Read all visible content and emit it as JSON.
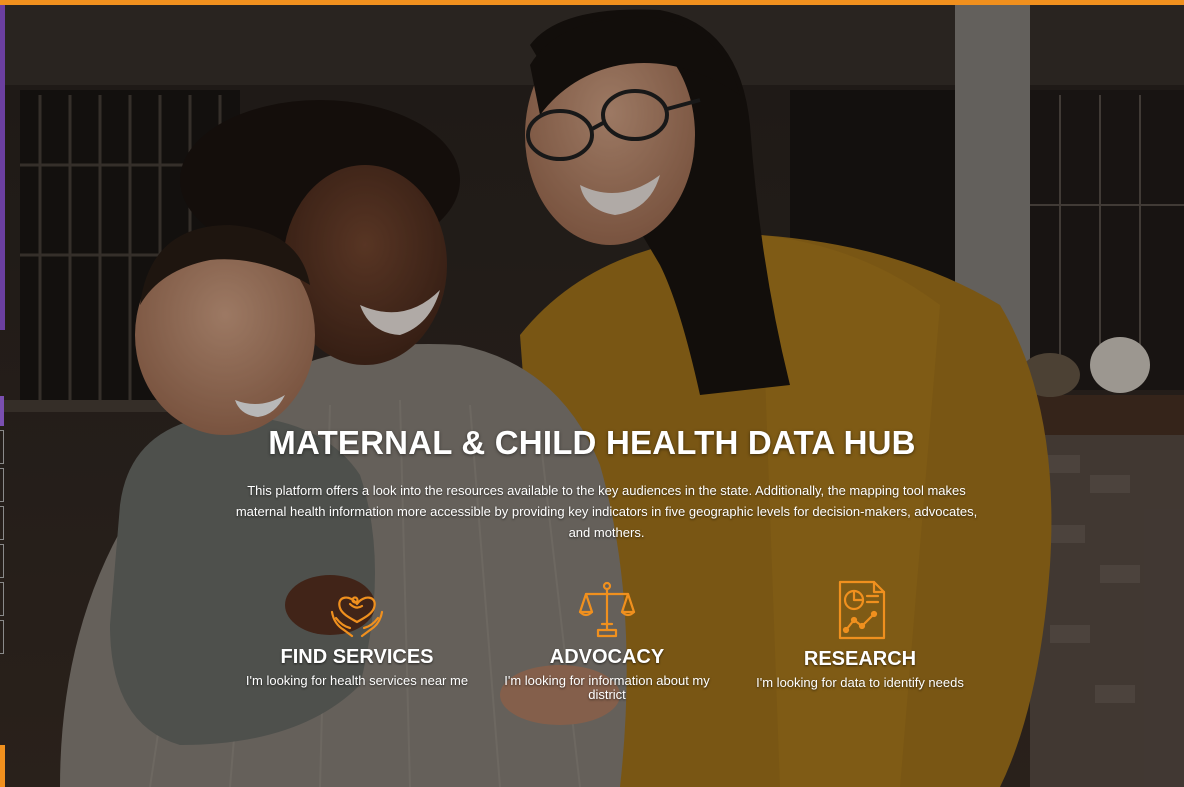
{
  "hero": {
    "title": "MATERNAL & CHILD HEALTH DATA HUB",
    "description": "This platform offers a look into the resources available to the key audiences in the state. Additionally, the mapping tool makes maternal health information more accessible by providing key indicators in five geographic levels for decision-makers, advocates, and mothers."
  },
  "cards": [
    {
      "label": "FIND SERVICES",
      "sub": "I'm looking for health services near me",
      "icon": "heart-hands-icon"
    },
    {
      "label": "ADVOCACY",
      "sub": "I'm looking for information about my district",
      "icon": "scales-icon"
    },
    {
      "label": "RESEARCH",
      "sub": "I'm looking for data to identify needs",
      "icon": "report-chart-icon"
    }
  ],
  "colors": {
    "accent_orange": "#f0901e",
    "accent_purple": "#6b3fa0",
    "icon_orange": "#f0901e"
  }
}
